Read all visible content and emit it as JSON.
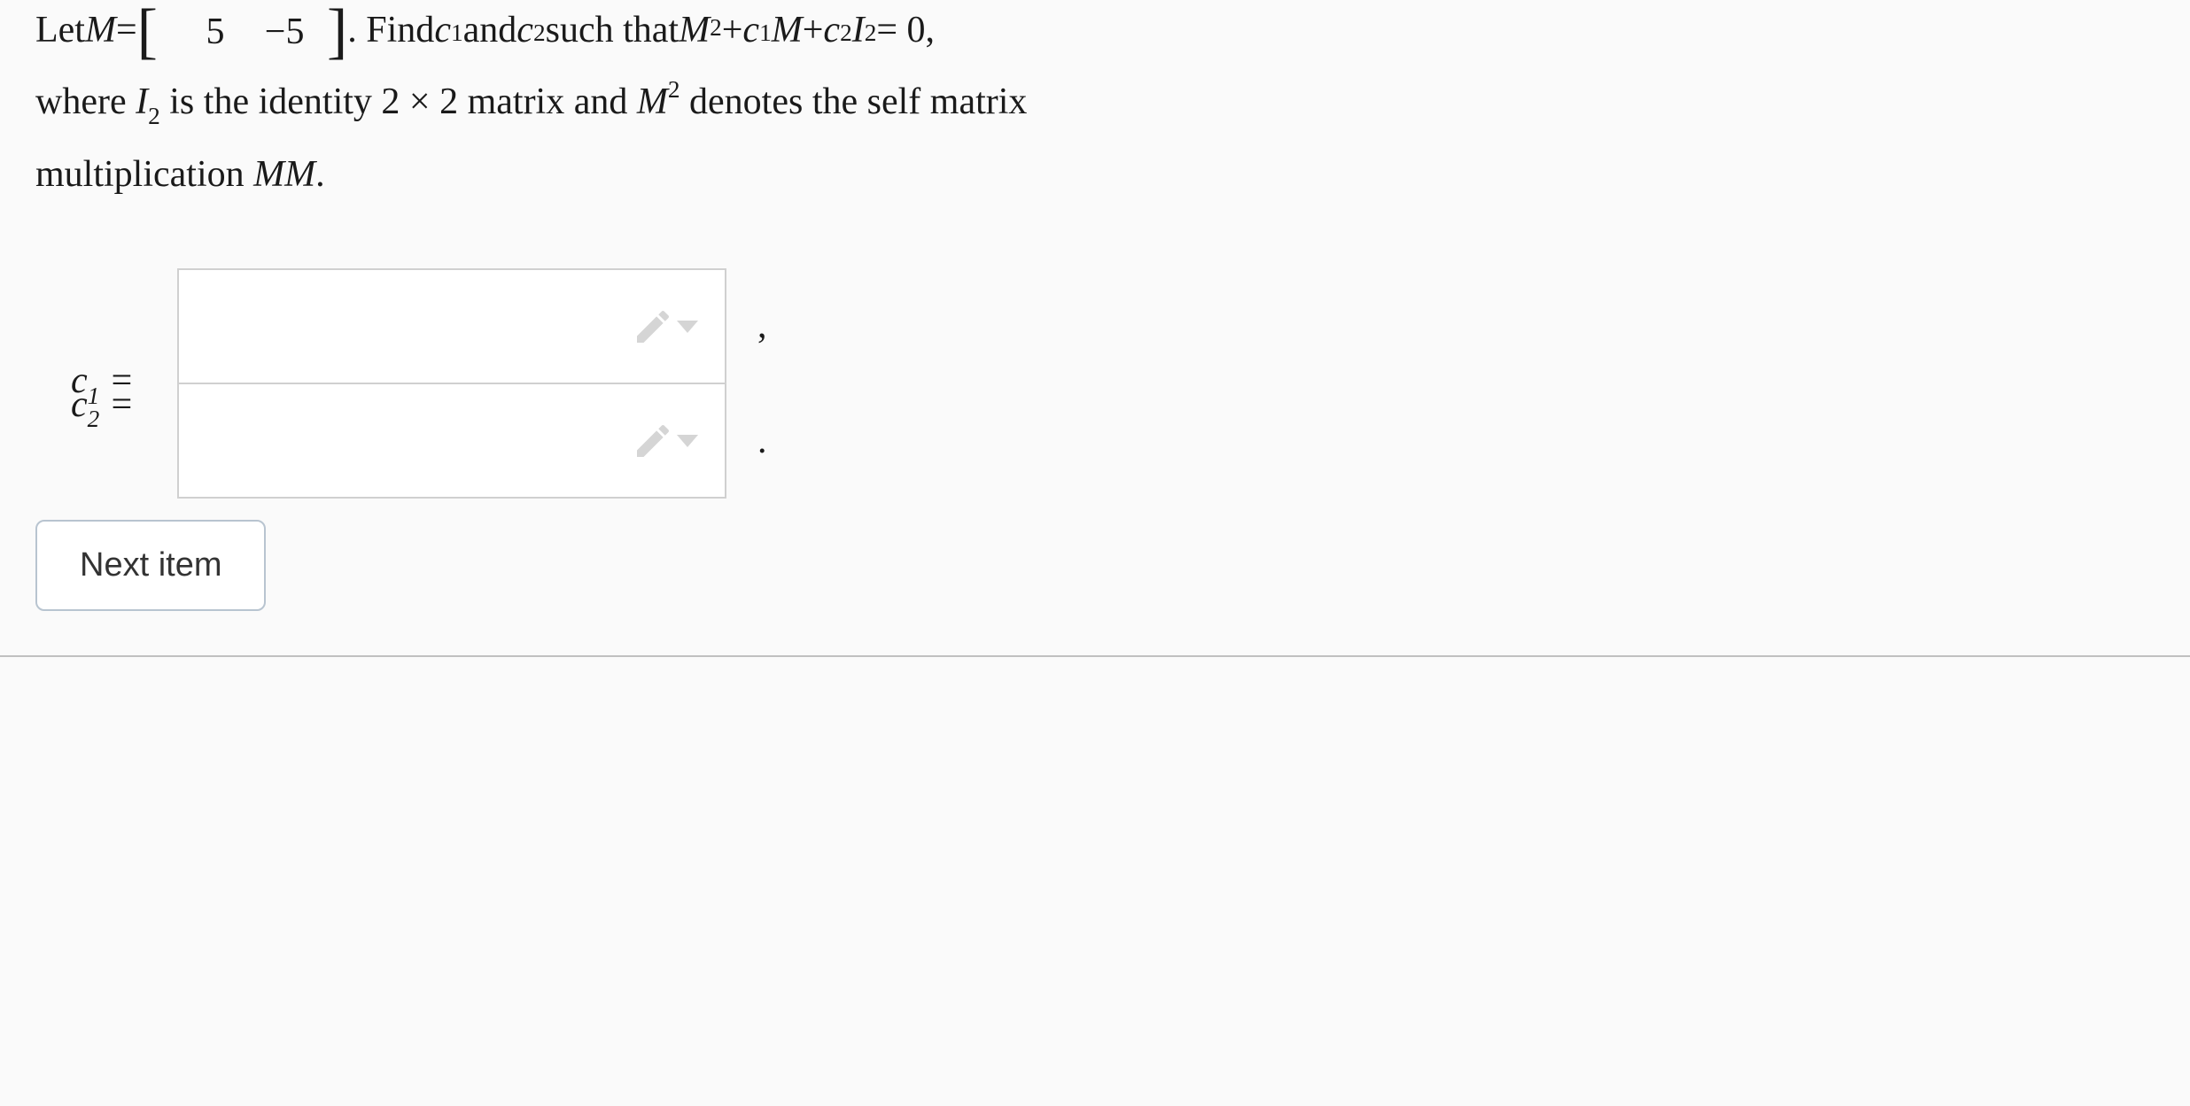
{
  "problem": {
    "line1_part1": "Let ",
    "var_M": "M",
    "equals": " = ",
    "matrix": {
      "row2": [
        "5",
        "−5"
      ]
    },
    "line1_part2": ". Find ",
    "c1": "c",
    "sub1": "1",
    "and": " and ",
    "c2": "c",
    "sub2": "2",
    "line1_part3": " such that ",
    "eq_M": "M",
    "eq_sup2": "2",
    "eq_plus1": " + ",
    "eq_c1": "c",
    "eq_sub1": "1",
    "eq_M2": "M",
    "eq_plus2": " + ",
    "eq_c2": "c",
    "eq_sub2": "2",
    "eq_I": "I",
    "eq_Isub": "2",
    "eq_rhs": " = 0,",
    "line2_part1": "where ",
    "line2_I": "I",
    "line2_Isub": "2",
    "line2_part2": " is the identity 2 × 2 matrix and ",
    "line2_M": "M",
    "line2_Msup": "2",
    "line2_part3": " denotes the self matrix",
    "line3": "multiplication ",
    "line3_MM": "MM",
    "line3_period": "."
  },
  "answers": {
    "c1_label_var": "c",
    "c1_label_sub": "1",
    "c1_label_eq": " =",
    "c1_value": "",
    "c1_suffix": ",",
    "c2_label_var": "c",
    "c2_label_sub": "2",
    "c2_label_eq": " =",
    "c2_value": "",
    "c2_suffix": "."
  },
  "button": {
    "next_label": "Next item"
  }
}
